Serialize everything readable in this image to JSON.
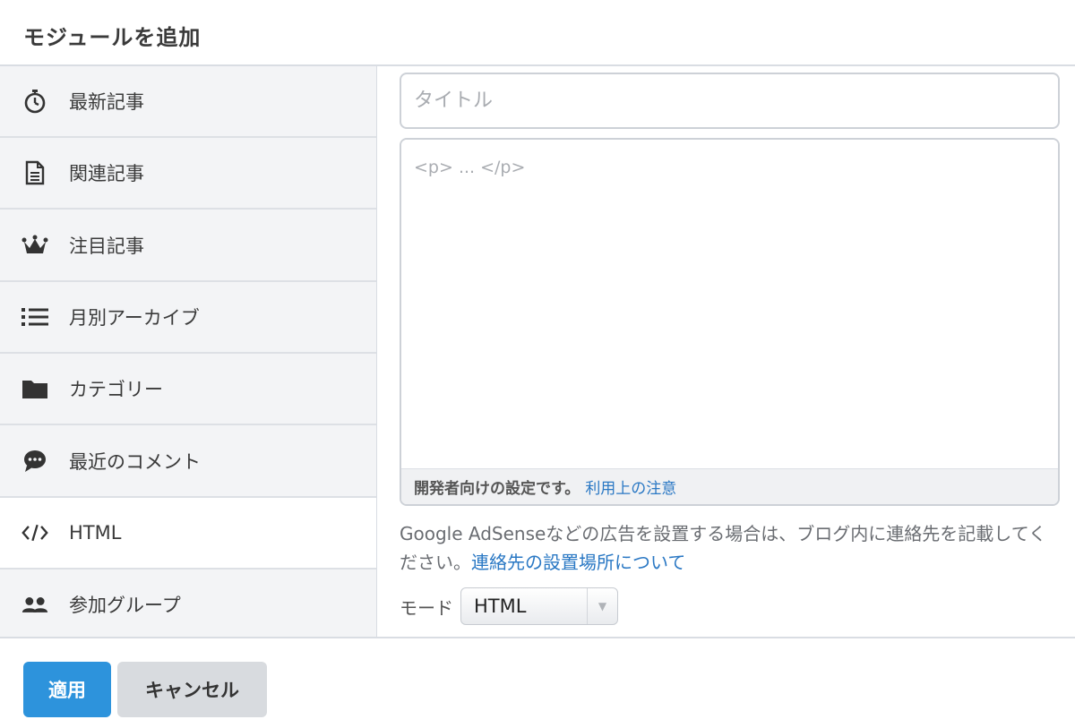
{
  "header": {
    "title": "モジュールを追加"
  },
  "sidebar": {
    "items": [
      {
        "label": "最新記事",
        "icon": "stopwatch-icon"
      },
      {
        "label": "関連記事",
        "icon": "document-icon"
      },
      {
        "label": "注目記事",
        "icon": "crown-icon"
      },
      {
        "label": "月別アーカイブ",
        "icon": "list-icon"
      },
      {
        "label": "カテゴリー",
        "icon": "folder-icon"
      },
      {
        "label": "最近のコメント",
        "icon": "comment-icon"
      },
      {
        "label": "HTML",
        "icon": "code-icon",
        "active": true
      },
      {
        "label": "参加グループ",
        "icon": "users-icon"
      }
    ]
  },
  "main": {
    "title_placeholder": "タイトル",
    "body_placeholder": "<p> ... </p>",
    "dev_note": "開発者向けの設定です。",
    "dev_link": "利用上の注意",
    "ad_note": "Google AdSenseなどの広告を設置する場合は、ブログ内に連絡先を記載してください。",
    "ad_link": "連絡先の設置場所について",
    "mode_label": "モード",
    "mode_value": "HTML"
  },
  "footer": {
    "apply_label": "適用",
    "cancel_label": "キャンセル"
  },
  "colors": {
    "accent": "#2d93dc",
    "link": "#2a78c4"
  }
}
